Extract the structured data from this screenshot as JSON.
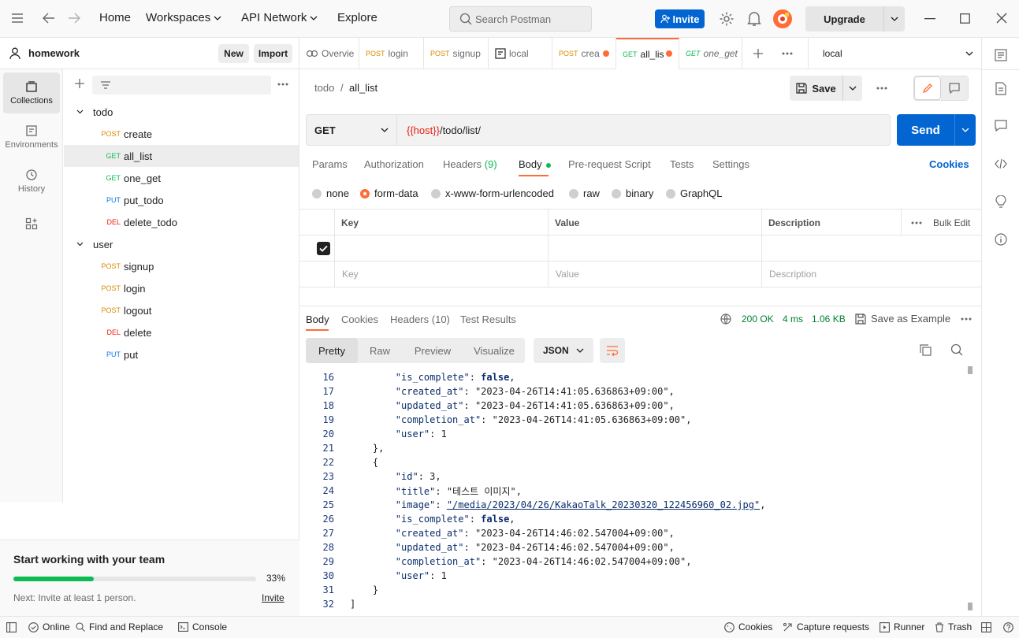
{
  "topbar": {
    "home": "Home",
    "workspaces": "Workspaces",
    "api_network": "API Network",
    "explore": "Explore",
    "search_placeholder": "Search Postman",
    "invite": "Invite",
    "upgrade": "Upgrade"
  },
  "sidebar": {
    "workspace": "homework",
    "new_label": "New",
    "import_label": "Import",
    "nav": [
      {
        "label": "Collections"
      },
      {
        "label": "Environments"
      },
      {
        "label": "History"
      }
    ],
    "tree": [
      {
        "type": "folder",
        "label": "todo"
      },
      {
        "type": "req",
        "method": "POST",
        "label": "create",
        "color": "#d98c00"
      },
      {
        "type": "req",
        "method": "GET",
        "label": "all_list",
        "color": "#0cbb52"
      },
      {
        "type": "req",
        "method": "GET",
        "label": "one_get",
        "color": "#0cbb52"
      },
      {
        "type": "req",
        "method": "PUT",
        "label": "put_todo",
        "color": "#097bed"
      },
      {
        "type": "req",
        "method": "DEL",
        "label": "delete_todo",
        "color": "#eb2013"
      },
      {
        "type": "folder",
        "label": "user"
      },
      {
        "type": "req",
        "method": "POST",
        "label": "signup",
        "color": "#d98c00"
      },
      {
        "type": "req",
        "method": "POST",
        "label": "login",
        "color": "#d98c00"
      },
      {
        "type": "req",
        "method": "POST",
        "label": "logout",
        "color": "#d98c00"
      },
      {
        "type": "req",
        "method": "DEL",
        "label": "delete",
        "color": "#eb2013"
      },
      {
        "type": "req",
        "method": "PUT",
        "label": "put",
        "color": "#097bed"
      }
    ],
    "team": {
      "title": "Start working with your team",
      "progress_pct": 33,
      "progress_text": "33%",
      "next": "Next: Invite at least 1 person.",
      "invite": "Invite"
    }
  },
  "tabs": [
    {
      "method": "",
      "label": "Overvie"
    },
    {
      "method": "POST",
      "label": "login"
    },
    {
      "method": "POST",
      "label": "signup"
    },
    {
      "method": "",
      "label": "local"
    },
    {
      "method": "POST",
      "label": "crea"
    },
    {
      "method": "GET",
      "label": "all_lis"
    },
    {
      "method": "GET",
      "label": "one_get"
    }
  ],
  "environment": "local",
  "request": {
    "breadcrumb_parent": "todo",
    "breadcrumb_sep": "/",
    "name": "all_list",
    "save": "Save",
    "method": "GET",
    "url_var": "{{host}}",
    "url_path": "/todo/list/",
    "send": "Send",
    "tabs": [
      "Params",
      "Authorization",
      "Headers",
      "(9)",
      "Body",
      "Pre-request Script",
      "Tests",
      "Settings"
    ],
    "cookies": "Cookies",
    "body_types": [
      "none",
      "form-data",
      "x-www-form-urlencoded",
      "raw",
      "binary",
      "GraphQL"
    ],
    "table": {
      "headers": [
        "Key",
        "Value",
        "Description"
      ],
      "bulk_edit": "Bulk Edit",
      "placeholders": [
        "Key",
        "Value",
        "Description"
      ]
    }
  },
  "response": {
    "tabs": [
      "Body",
      "Cookies",
      "Headers",
      "(10)",
      "Test Results"
    ],
    "status": "200 OK",
    "time": "4 ms",
    "size": "1.06 KB",
    "save_example": "Save as Example",
    "views": [
      "Pretty",
      "Raw",
      "Preview",
      "Visualize"
    ],
    "format": "JSON",
    "lines": [
      {
        "n": "16",
        "t": "        \"is_complete\": false,"
      },
      {
        "n": "17",
        "t": "        \"created_at\": \"2023-04-26T14:41:05.636863+09:00\","
      },
      {
        "n": "18",
        "t": "        \"updated_at\": \"2023-04-26T14:41:05.636863+09:00\","
      },
      {
        "n": "19",
        "t": "        \"completion_at\": \"2023-04-26T14:41:05.636863+09:00\","
      },
      {
        "n": "20",
        "t": "        \"user\": 1"
      },
      {
        "n": "21",
        "t": "    },"
      },
      {
        "n": "22",
        "t": "    {"
      },
      {
        "n": "23",
        "t": "        \"id\": 3,"
      },
      {
        "n": "24",
        "t": "        \"title\": \"테스트 이미지\","
      },
      {
        "n": "25",
        "t": "        \"image\": \"/media/2023/04/26/KakaoTalk_20230320_122456960_02.jpg\","
      },
      {
        "n": "26",
        "t": "        \"is_complete\": false,"
      },
      {
        "n": "27",
        "t": "        \"created_at\": \"2023-04-26T14:46:02.547004+09:00\","
      },
      {
        "n": "28",
        "t": "        \"updated_at\": \"2023-04-26T14:46:02.547004+09:00\","
      },
      {
        "n": "29",
        "t": "        \"completion_at\": \"2023-04-26T14:46:02.547004+09:00\","
      },
      {
        "n": "30",
        "t": "        \"user\": 1"
      },
      {
        "n": "31",
        "t": "    }"
      },
      {
        "n": "32",
        "t": "]"
      }
    ]
  },
  "footer": {
    "online": "Online",
    "find_replace": "Find and Replace",
    "console": "Console",
    "cookies": "Cookies",
    "capture": "Capture requests",
    "runner": "Runner",
    "trash": "Trash"
  },
  "colors": {
    "accent": "#ff6c37",
    "primary": "#0265d2",
    "get": "#0cbb52",
    "post": "#d98c00",
    "put": "#097bed",
    "del": "#eb2013",
    "status_ok": "#007f31"
  }
}
